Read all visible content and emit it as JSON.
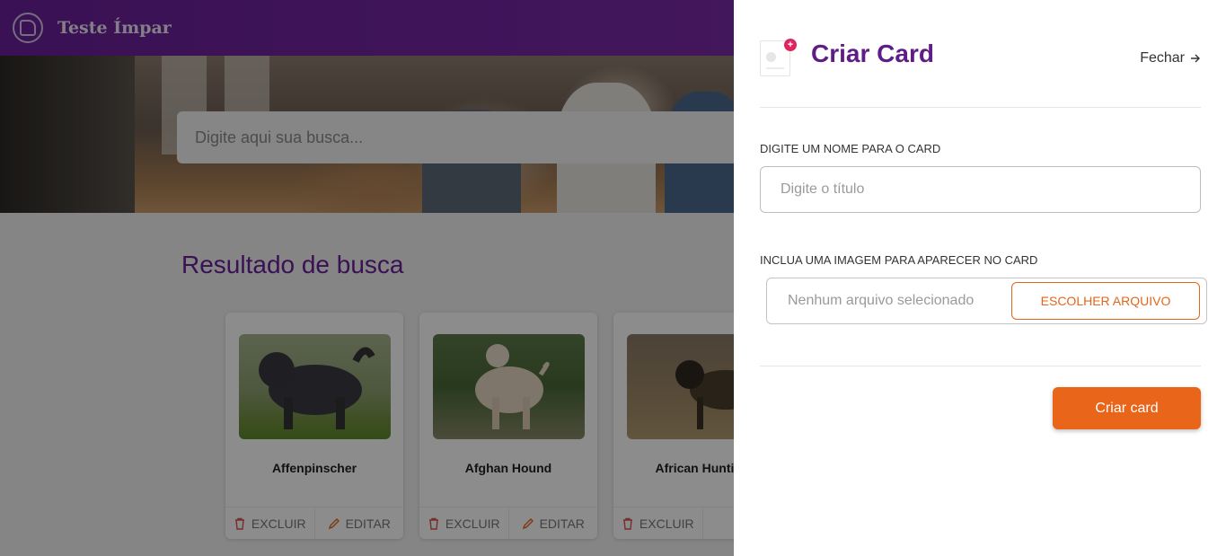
{
  "header": {
    "brand": "Teste Ímpar",
    "logo_icon": "chat-bubble-icon"
  },
  "search": {
    "placeholder": "Digite aqui sua busca..."
  },
  "results": {
    "title": "Resultado de busca",
    "cards": [
      {
        "name": "Affenpinscher",
        "delete_label": "EXCLUIR",
        "edit_label": "EDITAR"
      },
      {
        "name": "Afghan Hound",
        "delete_label": "EXCLUIR",
        "edit_label": "EDITAR"
      },
      {
        "name": "African Hunting",
        "delete_label": "EXCLUIR",
        "edit_label": ""
      }
    ]
  },
  "drawer": {
    "title": "Criar Card",
    "close_label": "Fechar",
    "name_label": "DIGITE UM NOME PARA O CARD",
    "name_placeholder": "Digite o título",
    "image_label": "INCLUA UMA IMAGEM PARA APARECER NO CARD",
    "file_status": "Nenhum arquivo selecionado",
    "file_button": "ESCOLHER ARQUIVO",
    "submit_label": "Criar card"
  },
  "colors": {
    "primary": "#6a1f9a",
    "accent": "#e8651a",
    "badge": "#e0245e"
  }
}
